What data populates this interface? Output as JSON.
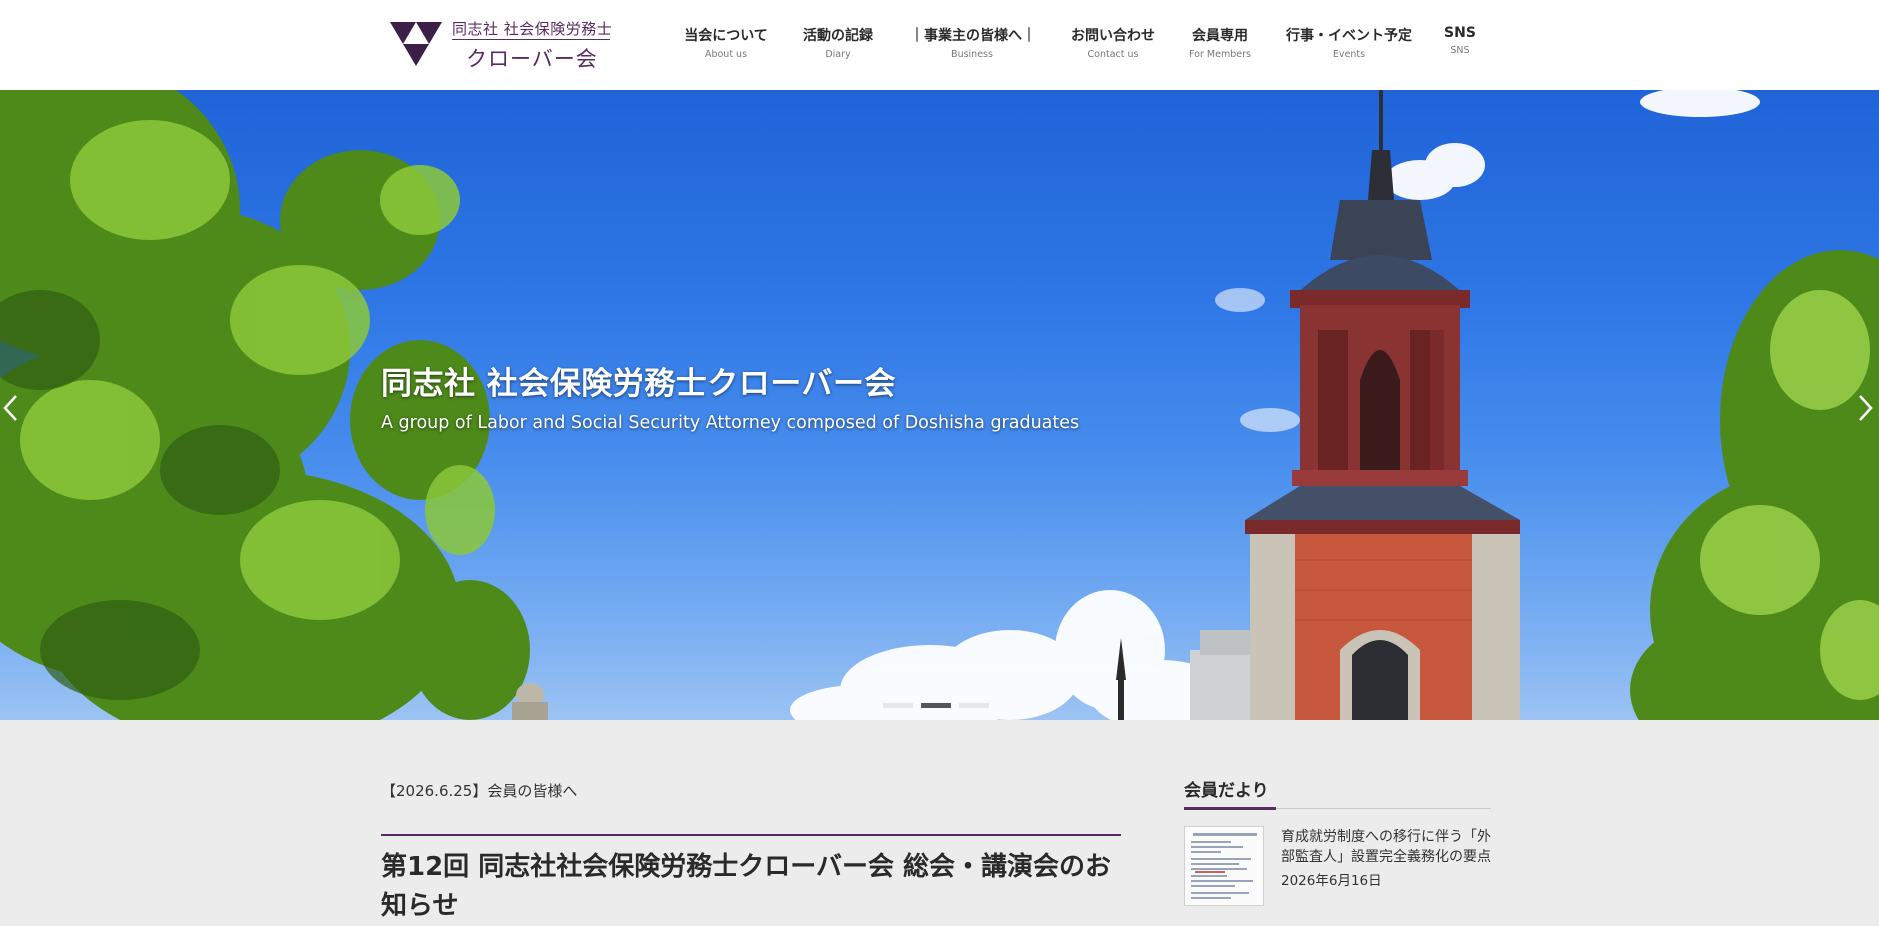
{
  "header": {
    "logo_top": "同志社 社会保険労務士",
    "logo_bottom": "クローバー会",
    "brand_color": "#5a2a63"
  },
  "nav": [
    {
      "label": "当会について",
      "sub": "About us"
    },
    {
      "label": "活動の記録",
      "sub": "Diary"
    },
    {
      "label": "｜事業主の皆様へ｜",
      "sub": "Business"
    },
    {
      "label": "お問い合わせ",
      "sub": "Contact us"
    },
    {
      "label": "会員専用",
      "sub": "For Members"
    },
    {
      "label": "行事・イベント予定",
      "sub": "Events"
    },
    {
      "label": "SNS",
      "sub": "SNS"
    }
  ],
  "hero": {
    "title": "同志社 社会保険労務士クローバー会",
    "subtitle": "A group of Labor and Social Security Attorney composed of Doshisha graduates",
    "prev_icon": "chevron-left-icon",
    "next_icon": "chevron-right-icon",
    "slide_count": 3,
    "active_slide": 2
  },
  "post": {
    "meta": "【2026.6.25】会員の皆様へ",
    "title": "第12回 同志社社会保険労務士クローバー会 総会・講演会のお知らせ"
  },
  "sidebar": {
    "heading": "会員だより",
    "items": [
      {
        "title": "育成就労制度への移行に伴う「外部監査人」設置完全義務化の要点",
        "date": "2026年6月16日"
      }
    ]
  }
}
